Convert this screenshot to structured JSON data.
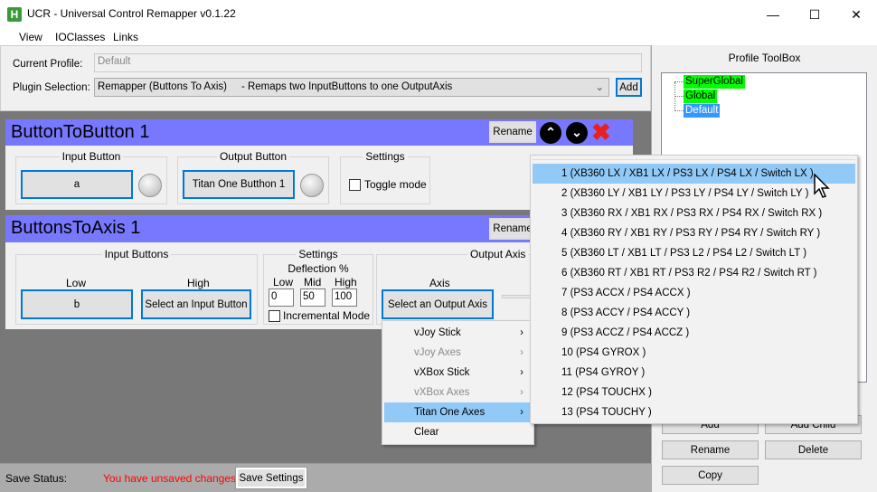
{
  "window": {
    "title": "UCR - Universal Control Remapper v0.1.22",
    "icon": "H",
    "minimize": "—",
    "maximize": "☐",
    "close": "✕"
  },
  "menu": [
    "View",
    "IOClasses",
    "Links"
  ],
  "top": {
    "current_profile_label": "Current Profile:",
    "current_profile_value": "Default",
    "plugin_selection_label": "Plugin Selection:",
    "plugin_selection_value": "Remapper (Buttons To Axis)     - Remaps two InputButtons to one OutputAxis",
    "add_label": "Add"
  },
  "plugin1": {
    "title": "ButtonToButton 1",
    "rename": "Rename",
    "input_group": "Input Button",
    "input_value": "a",
    "output_group": "Output Button",
    "output_value": "Titan One Butthon 1",
    "settings_group": "Settings",
    "toggle_mode": "Toggle mode"
  },
  "plugin2": {
    "title": "ButtonsToAxis 1",
    "rename": "Rename",
    "input_group": "Input Buttons",
    "low_label": "Low",
    "low_value": "b",
    "high_label": "High",
    "high_value": "Select an Input Button",
    "settings_group": "Settings",
    "deflection_label": "Deflection %",
    "def_low_label": "Low",
    "def_mid_label": "Mid",
    "def_high_label": "High",
    "def_low": "0",
    "def_mid": "50",
    "def_high": "100",
    "incremental_mode": "Incremental Mode",
    "output_group": "Output Axis",
    "axis_label": "Axis",
    "axis_value": "Select an Output Axis"
  },
  "context_menu": [
    {
      "label": "vJoy Stick",
      "enabled": true
    },
    {
      "label": "vJoy Axes",
      "enabled": false
    },
    {
      "label": "vXBox Stick",
      "enabled": true
    },
    {
      "label": "vXBox Axes",
      "enabled": false
    },
    {
      "label": "Titan One Axes",
      "enabled": true,
      "highlighted": true
    },
    {
      "label": "Clear",
      "enabled": true
    }
  ],
  "submenu": [
    "1 (XB360 LX / XB1 LX / PS3 LX / PS4 LX / Switch LX )",
    "2 (XB360 LY / XB1 LY / PS3 LY / PS4 LY / Switch LY )",
    "3 (XB360 RX / XB1 RX / PS3 RX / PS4 RX / Switch RX )",
    "4 (XB360 RY / XB1 RY / PS3 RY / PS4 RY / Switch RY )",
    "5 (XB360 LT / XB1 LT / PS3 L2 / PS4 L2 / Switch LT )",
    "6 (XB360 RT / XB1 RT / PS3 R2 / PS4 R2 / Switch RT )",
    "7 (PS3 ACCX / PS4 ACCX )",
    "8 (PS3 ACCY / PS4 ACCY )",
    "9 (PS3 ACCZ / PS4 ACCZ )",
    "10 (PS4 GYROX )",
    "11 (PS4 GYROY )",
    "12 (PS4 TOUCHX )",
    "13 (PS4 TOUCHY )"
  ],
  "status": {
    "label": "Save Status:",
    "message": "You have unsaved changes",
    "save": "Save Settings",
    "message_color": "#ff0000"
  },
  "toolbox": {
    "title": "Profile ToolBox",
    "tree": [
      "SuperGlobal",
      "Global",
      "Default"
    ],
    "add": "Add",
    "add_child": "Add Child",
    "rename": "Rename",
    "delete": "Delete",
    "copy": "Copy"
  },
  "colors": {
    "plugin_header": "#7878ff",
    "highlight": "#91c9f7",
    "node_green": "#00ff00",
    "node_selected": "#3399ff"
  }
}
